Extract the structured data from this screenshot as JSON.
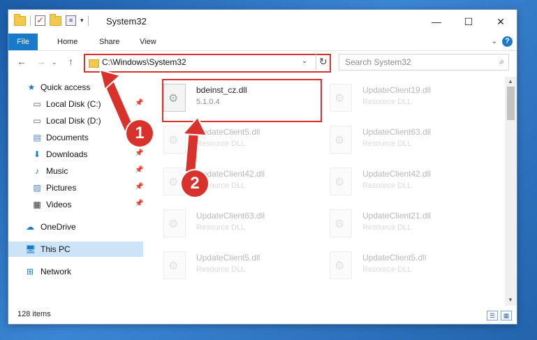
{
  "window": {
    "title": "System32",
    "controls": {
      "minimize": "—",
      "maximize": "☐",
      "close": "✕"
    }
  },
  "ribbon": {
    "tabs": [
      "File",
      "Home",
      "Share",
      "View"
    ],
    "help": "?"
  },
  "navigation": {
    "address": "C:\\Windows\\System32",
    "search_placeholder": "Search System32"
  },
  "sidebar": {
    "items": [
      {
        "label": "Quick access",
        "icon": "star-icon",
        "pinned": false
      },
      {
        "label": "Local Disk (C:)",
        "icon": "drive-icon",
        "pinned": true
      },
      {
        "label": "Local Disk (D:)",
        "icon": "drive-icon",
        "pinned": false
      },
      {
        "label": "Documents",
        "icon": "documents-icon",
        "pinned": true
      },
      {
        "label": "Downloads",
        "icon": "download-icon",
        "pinned": true
      },
      {
        "label": "Music",
        "icon": "music-icon",
        "pinned": true
      },
      {
        "label": "Pictures",
        "icon": "pictures-icon",
        "pinned": true
      },
      {
        "label": "Videos",
        "icon": "videos-icon",
        "pinned": true
      },
      {
        "label": "OneDrive",
        "icon": "cloud-icon",
        "pinned": false
      },
      {
        "label": "This PC",
        "icon": "computer-icon",
        "pinned": false,
        "selected": true
      },
      {
        "label": "Network",
        "icon": "network-icon",
        "pinned": false
      }
    ]
  },
  "files": {
    "highlighted": {
      "name": "bdeinst_cz.dll",
      "detail": "5.1.0.4"
    },
    "others": [
      {
        "name": "UpdateClient19.dll",
        "detail": "Resource DLL"
      },
      {
        "name": "UpdateClient5.dll",
        "detail": "Resource DLL"
      },
      {
        "name": "UpdateClient63.dll",
        "detail": "Resource DLL"
      },
      {
        "name": "UpdateClient42.dll",
        "detail": "Resource DLL"
      },
      {
        "name": "UpdateClient42.dll",
        "detail": "Resource DLL"
      },
      {
        "name": "UpdateClient63.dll",
        "detail": "Resource DLL"
      },
      {
        "name": "UpdateClient21.dll",
        "detail": "Resource DLL"
      },
      {
        "name": "UpdateClient5.dll",
        "detail": "Resource DLL"
      },
      {
        "name": "UpdateClient5.dll",
        "detail": "Resource DLL"
      }
    ]
  },
  "status": {
    "item_count": "128 items"
  },
  "annotations": {
    "step1": "1",
    "step2": "2",
    "color": "#d9312c"
  }
}
